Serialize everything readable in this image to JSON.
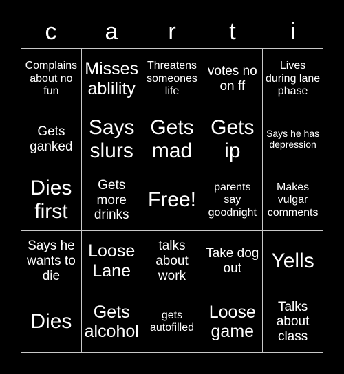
{
  "card": {
    "header_letters": [
      "c",
      "a",
      "r",
      "t",
      "i"
    ],
    "background_color": "#000000",
    "text_color": "#ffffff",
    "grid_line_color": "#c8c8c8",
    "rows": [
      [
        {
          "text": "Complains about no fun",
          "size": "s"
        },
        {
          "text": "Misses ablility",
          "size": "l"
        },
        {
          "text": "Threatens someones life",
          "size": "s"
        },
        {
          "text": "votes no on ff",
          "size": "m"
        },
        {
          "text": "Lives during lane phase",
          "size": "s"
        }
      ],
      [
        {
          "text": "Gets ganked",
          "size": "m"
        },
        {
          "text": "Says slurs",
          "size": "xl"
        },
        {
          "text": "Gets mad",
          "size": "xl"
        },
        {
          "text": "Gets ip",
          "size": "xl"
        },
        {
          "text": "Says he has depression",
          "size": "xs"
        }
      ],
      [
        {
          "text": "Dies first",
          "size": "xl"
        },
        {
          "text": "Gets more drinks",
          "size": "m"
        },
        {
          "text": "Free!",
          "size": "free"
        },
        {
          "text": "parents say goodnight",
          "size": "s"
        },
        {
          "text": "Makes vulgar comments",
          "size": "s"
        }
      ],
      [
        {
          "text": "Says he wants to die",
          "size": "m"
        },
        {
          "text": "Loose Lane",
          "size": "l"
        },
        {
          "text": "talks about work",
          "size": "m"
        },
        {
          "text": "Take dog out",
          "size": "m"
        },
        {
          "text": "Yells",
          "size": "xl"
        }
      ],
      [
        {
          "text": "Dies",
          "size": "xl"
        },
        {
          "text": "Gets alcohol",
          "size": "l"
        },
        {
          "text": "gets autofilled",
          "size": "s"
        },
        {
          "text": "Loose game",
          "size": "l"
        },
        {
          "text": "Talks about class",
          "size": "m"
        }
      ]
    ]
  }
}
